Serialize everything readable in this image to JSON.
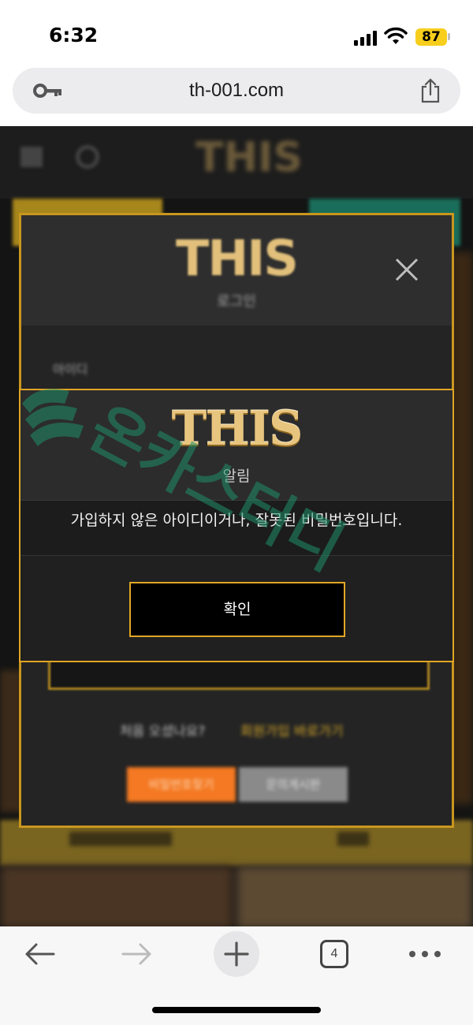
{
  "status_bar": {
    "time": "6:32",
    "battery": "87"
  },
  "browser": {
    "url": "th-001.com",
    "tab_count": "4"
  },
  "page_background": {
    "logo": "THIS",
    "login_modal": {
      "logo": "THIS",
      "subtitle": "로그인",
      "id_label": "아이디",
      "first_visit_text": "처음 오셨나요?",
      "join_link": "회원가입 바로가기",
      "find_password_button": "비밀번호찾기",
      "inquiry_button": "문의게시판"
    }
  },
  "alert": {
    "logo": "THIS",
    "title": "알림",
    "message": "가입하지 않은 아이디이거나, 잘못된 비밀번호입니다.",
    "confirm_label": "확인"
  },
  "watermark": {
    "text": "온카스터디",
    "color": "#1f8f6a"
  },
  "colors": {
    "accent_gold": "#e0a624",
    "orange": "#f47922",
    "battery": "#f7ce1c"
  }
}
